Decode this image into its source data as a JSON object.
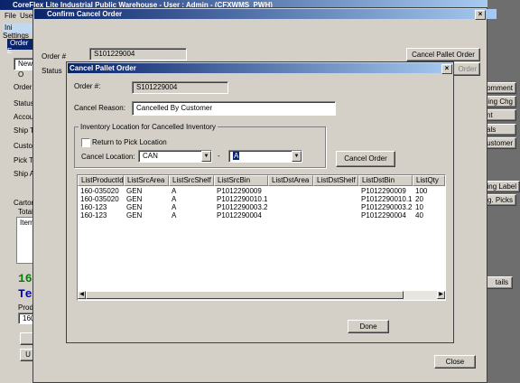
{
  "main_window": {
    "title": "CoreFlex Lite Industrial Public Warehouse - User : Admin - (CFXWMS_PWH)",
    "menu": [
      "File",
      "User"
    ],
    "toolbar_tab": "Ini Settings",
    "order_tab": "Order E",
    "new_field": "New O",
    "labels": [
      "Order #",
      "Status",
      "Accou",
      "Ship T",
      "Custo",
      "Pick Ti",
      "Ship A",
      "Carton",
      "Total",
      "Item"
    ],
    "prod_label": "Prod",
    "prod_value": "160",
    "green_text": "16",
    "blue_text": "Te",
    "u_button": "U",
    "right_buttons": [
      "omment",
      "ping Chg",
      "nt",
      "als",
      "ustomer",
      "ping Label",
      "g. Picks",
      "tails"
    ]
  },
  "confirm_dialog": {
    "title": "Confirm Cancel Order",
    "order_label": "Order #",
    "order_value": "S101229004",
    "status_label": "Status",
    "cancel_pallet_btn": "Cancel Pallet Order",
    "second_btn": "Order",
    "close_btn": "Close"
  },
  "pallet_dialog": {
    "title": "Cancel Pallet Order",
    "order_label": "Order #:",
    "order_value": "S101229004",
    "reason_label": "Cancel Reason:",
    "reason_value": "Cancelled By Customer",
    "group_title": "Inventory Location for Cancelled Inventory",
    "return_checkbox_label": "Return to Pick Location",
    "cancel_location_label": "Cancel Location:",
    "location_value": "CAN",
    "separator": "-",
    "sub_location_value": "A",
    "cancel_order_btn": "Cancel Order",
    "done_btn": "Done",
    "columns": [
      "ListProductId",
      "ListSrcArea",
      "ListSrcShelf",
      "ListSrcBin",
      "ListDstArea",
      "ListDstShelf",
      "ListDstBin",
      "ListQty"
    ],
    "rows": [
      [
        "160-035020",
        "GEN",
        "A",
        "P1012290009",
        "",
        "",
        "P1012290009",
        "100"
      ],
      [
        "160-035020",
        "GEN",
        "A",
        "P1012290010.1",
        "",
        "",
        "P1012290010.1",
        "20"
      ],
      [
        "160-123",
        "GEN",
        "A",
        "P1012290003.2",
        "",
        "",
        "P1012290003.2",
        "10"
      ],
      [
        "160-123",
        "GEN",
        "A",
        "P1012290004",
        "",
        "",
        "P1012290004",
        "40"
      ]
    ]
  },
  "colors": {
    "title_start": "#0a246a",
    "title_end": "#a6caf0",
    "face": "#d4d0c8",
    "highlight_blue": "#0a246a"
  }
}
